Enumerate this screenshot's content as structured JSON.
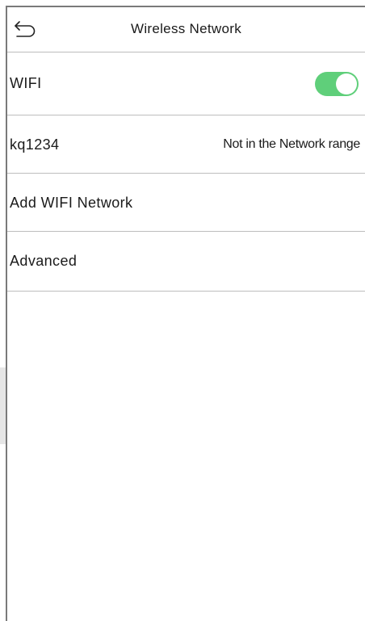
{
  "header": {
    "title": "Wireless Network"
  },
  "items": {
    "wifi": {
      "label": "WIFI",
      "enabled": true,
      "toggle_color": "#5fcf7a"
    },
    "network": {
      "ssid": "kq1234",
      "status": "Not in the Network range"
    },
    "add_network": {
      "label": "Add WIFI Network"
    },
    "advanced": {
      "label": "Advanced"
    }
  },
  "icons": {
    "back": "back-arrow-icon"
  }
}
